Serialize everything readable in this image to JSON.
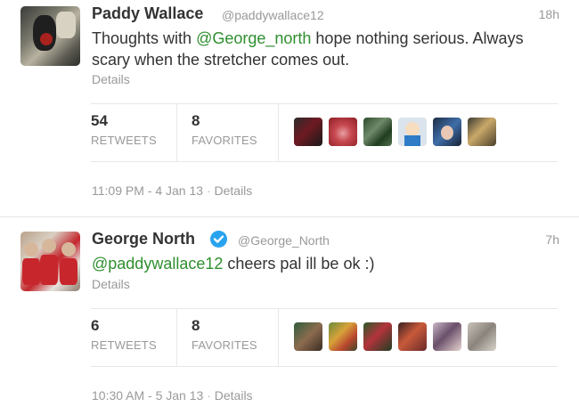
{
  "tweets": [
    {
      "name": "Paddy Wallace",
      "handle": "@paddywallace12",
      "time": "18h",
      "text_mention": "@George_north",
      "text_before": "Thoughts with ",
      "text_after": " hope nothing serious. Always scary when the stretcher comes out.",
      "details": "Details",
      "retweets": "54",
      "retweets_label": "RETWEETS",
      "favorites": "8",
      "favorites_label": "FAVORITES",
      "timestamp": "11:09 PM - 4 Jan 13",
      "footer_sep": "·",
      "footer_details": "Details"
    },
    {
      "name": "George North",
      "handle": "@George_North",
      "time": "7h",
      "verified": true,
      "text_before": "",
      "text_mention": "@paddywallace12",
      "text_after": " cheers pal ill be ok :)",
      "details": "Details",
      "retweets": "6",
      "retweets_label": "RETWEETS",
      "favorites": "8",
      "favorites_label": "FAVORITES",
      "timestamp": "10:30 AM - 5 Jan 13",
      "footer_sep": "·",
      "footer_details": "Details"
    }
  ],
  "colors": {
    "mention": "#2f8f2f",
    "muted": "#999999",
    "verified": "#2aa3ef"
  }
}
